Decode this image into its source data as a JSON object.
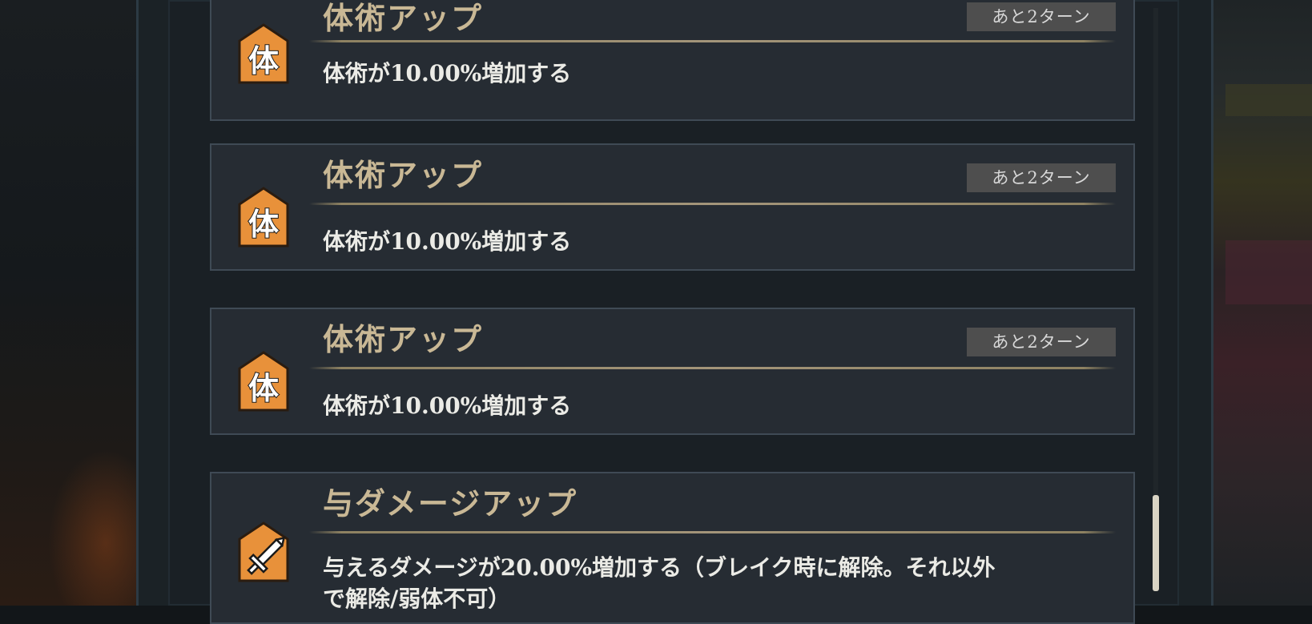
{
  "buffs": [
    {
      "title": "体術アップ",
      "turns": "あと2ターン",
      "desc": "体術が10.00%増加する",
      "icon_text": "体"
    },
    {
      "title": "体術アップ",
      "turns": "あと2ターン",
      "desc": "体術が10.00%増加する",
      "icon_text": "体"
    },
    {
      "title": "体術アップ",
      "turns": "あと2ターン",
      "desc": "体術が10.00%増加する",
      "icon_text": "体"
    },
    {
      "title": "与ダメージアップ",
      "desc_line1": "与えるダメージが20.00%増加する（ブレイク時に解除。それ以外",
      "desc_line2": "で解除/弱体不可）",
      "icon": "sword-icon"
    }
  ],
  "colors": {
    "icon_orange": "#e8913a",
    "title_gold": "#c9b895",
    "badge_bg": "#4e4e4e"
  }
}
